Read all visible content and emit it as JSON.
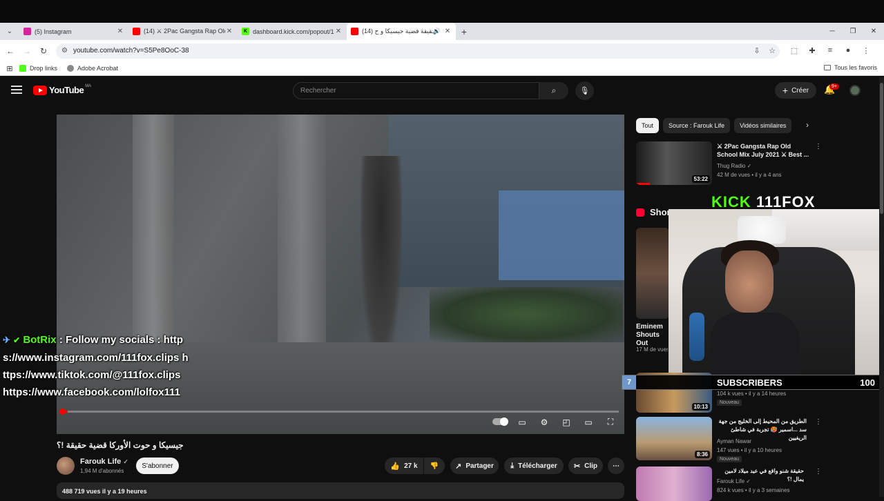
{
  "browser": {
    "tabs": [
      {
        "title": "(5) Instagram",
        "active": false,
        "fav_color": "#d6249f"
      },
      {
        "title": "(14) ⚔ 2Pac Gangsta Rap Old",
        "active": false,
        "fav_color": "#ff0000"
      },
      {
        "title": "dashboard.kick.com/popout/1",
        "active": false,
        "fav_color": "#53fc18"
      },
      {
        "title": "(14) حقيقة قضية جيسيكا و ح...",
        "active": true,
        "fav_color": "#ff0000"
      }
    ],
    "url": "youtube.com/watch?v=S5Pe8OoC-38",
    "bookmarks": [
      {
        "label": "Drop links"
      },
      {
        "label": "Adobe Acrobat"
      }
    ],
    "all_favorites": "Tous les favoris"
  },
  "youtube": {
    "logo_text": "YouTube",
    "logo_country": "MA",
    "search_placeholder": "Rechercher",
    "create_label": "Créer",
    "notif_badge": "9+"
  },
  "video": {
    "progress_fraction": 0.01,
    "title": "جيسيكا و حوت الأوركا قضية حقيقة !؟",
    "channel": "Farouk Life",
    "subscribers": "1,94 M d'abonnés",
    "subscribe_label": "S'abonner",
    "likes": "27 k",
    "share_label": "Partager",
    "download_label": "Télécharger",
    "clip_label": "Clip",
    "views_date": "488 719 vues  il y a 19 heures"
  },
  "chat": {
    "user": "BotRix",
    "message": ": Follow my socials : https://www.instagram.com/111fox.clips https://www.tiktok.com/@111fox.clips https://www.facebook.com/lolfox111"
  },
  "sidebar": {
    "chips": [
      "Tout",
      "Source : Farouk Life",
      "Vidéos similaires"
    ],
    "items": [
      {
        "title": "⚔ 2Pac Gangsta Rap Old School Mix July 2021 ⚔ Best ...",
        "channel": "Thug Radio",
        "meta": "42 M de vues • il y a 4 ans",
        "duration": "53:22"
      },
      {
        "title": "...",
        "channel": "",
        "meta": "104 k vues • il y a 14 heures",
        "duration": "10:13",
        "badge": "Nouveau"
      },
      {
        "title": "الطريق من المحيط إلى الخليج من جهة سد ...اسمير 🥵 تجربة في شاطئ الريفيين",
        "channel": "Ayman Nawar",
        "meta": "147 vues • il y a 10 heures",
        "duration": "8:36",
        "badge": "Nouveau"
      },
      {
        "title": "حقيقة شنو واقع في عيد ميلاد لامين يمال !؟",
        "channel": "Farouk Life",
        "meta": "824 k vues • il y a 3 semaines",
        "duration": ""
      }
    ],
    "shorts_title": "Shorts",
    "short_caption": "Eminem Shouts Out",
    "short_views": "17 M de vues"
  },
  "stream_overlay": {
    "kick_word": "KICK",
    "channel_word": "111FOX",
    "subs_count": "7",
    "subs_label": "SUBSCRIBERS",
    "subs_goal": "100"
  }
}
